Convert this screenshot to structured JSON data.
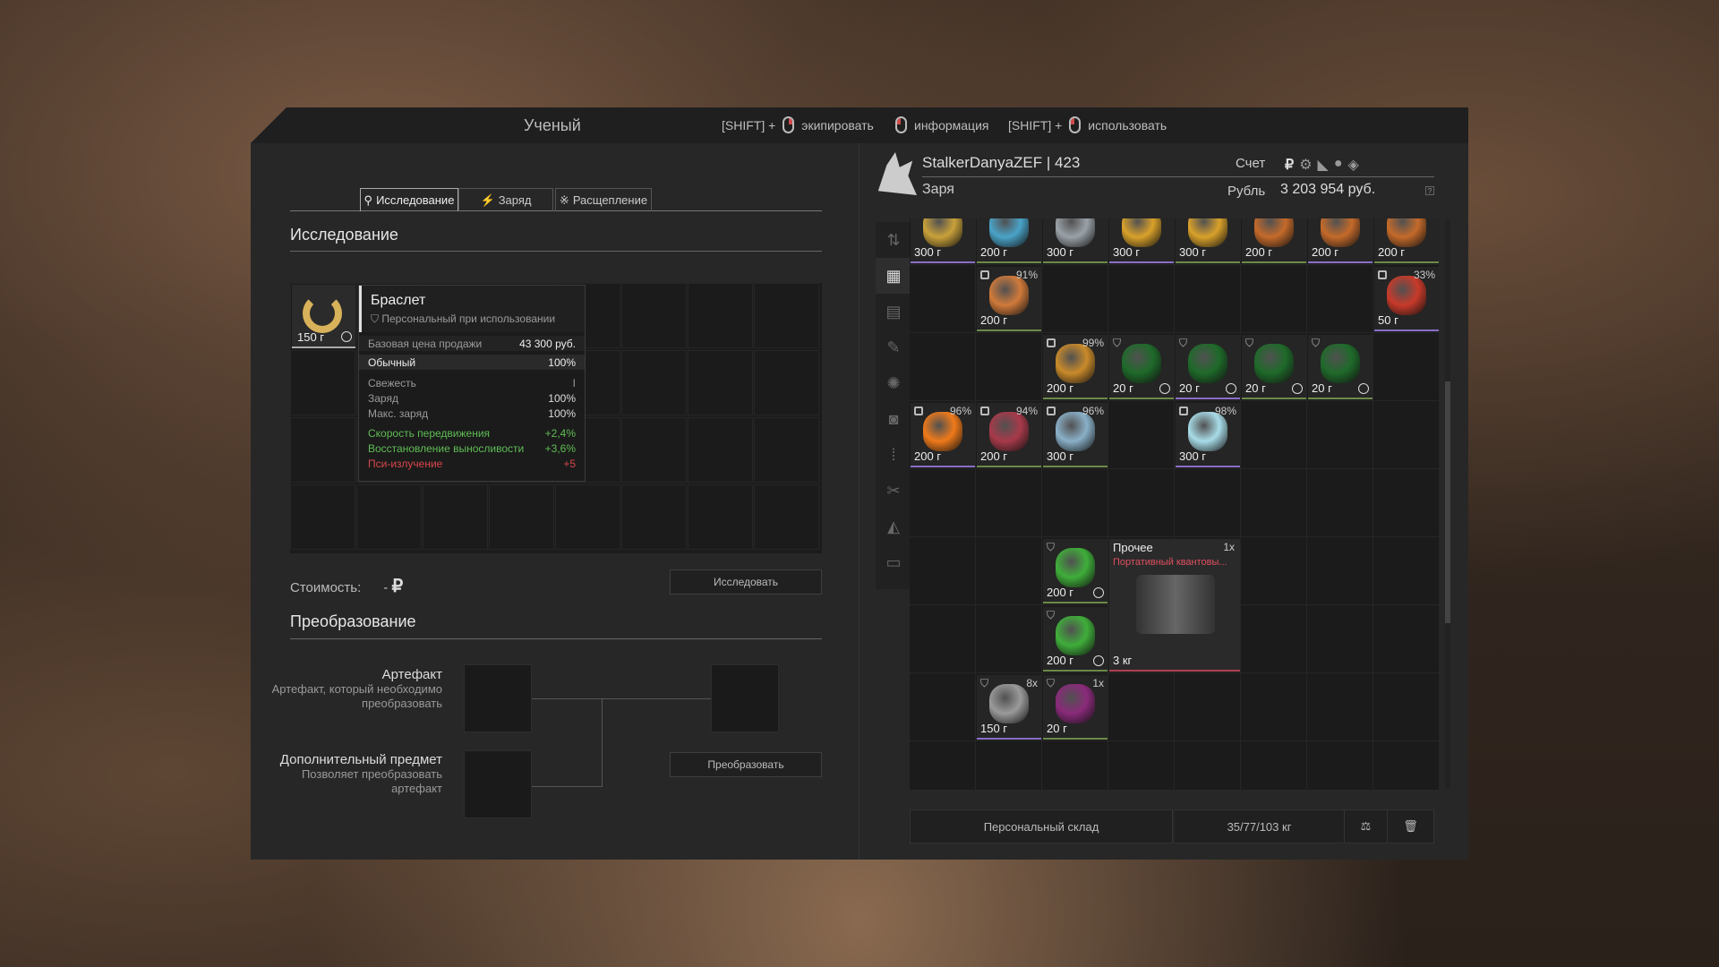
{
  "header": {
    "title": "Ученый",
    "hints": [
      {
        "prefix": "[SHIFT] +",
        "label": "экипировать"
      },
      {
        "prefix": "",
        "label": "информация"
      },
      {
        "prefix": "[SHIFT] +",
        "label": "использовать"
      }
    ]
  },
  "tabs": [
    {
      "label": "Исследование",
      "icon": "magnifier-icon",
      "active": true
    },
    {
      "label": "Заряд",
      "icon": "lightning-icon",
      "active": false
    },
    {
      "label": "Расщепление",
      "icon": "split-icon",
      "active": false
    }
  ],
  "research": {
    "title": "Исследование",
    "item_weight": "150 г",
    "tooltip": {
      "name": "Браслет",
      "subtitle": "Персональный при использовании",
      "base_price_label": "Базовая цена продажи",
      "base_price_value": "43 300 руб.",
      "rarity_label": "Обычный",
      "rarity_value": "100%",
      "freshness_label": "Свежесть",
      "freshness_value": "I",
      "charge_label": "Заряд",
      "charge_value": "100%",
      "max_charge_label": "Макс. заряд",
      "max_charge_value": "100%",
      "bonuses": [
        {
          "label": "Скорость передвижения",
          "value": "+2,4%",
          "color": "green"
        },
        {
          "label": "Восстановление выносливости",
          "value": "+3,6%",
          "color": "green"
        },
        {
          "label": "Пси-излучение",
          "value": "+5",
          "color": "red"
        }
      ]
    },
    "cost_label": "Стоимость:",
    "cost_value": "-",
    "currency_symbol": "₽",
    "button": "Исследовать"
  },
  "transform": {
    "title": "Преобразование",
    "artifact_label": "Артефакт",
    "artifact_desc": "Артефакт, который необходимо преобразовать",
    "extra_label": "Дополнительный предмет",
    "extra_desc": "Позволяет преобразовать артефакт",
    "button": "Преобразовать"
  },
  "account": {
    "player": "StalkerDanyaZEF | 423",
    "faction": "Заря",
    "account_label": "Счет",
    "currency_label": "Рубль",
    "balance": "3 203 954 руб."
  },
  "inventory": {
    "footer_label": "Персональный склад",
    "weight": "35/77/103 кг",
    "items": [
      {
        "w": "300 г",
        "c": "#c9a13a"
      },
      {
        "w": "200 г",
        "c": "#4aa3c8"
      },
      {
        "w": "300 г",
        "c": "#9aa2a8"
      },
      {
        "w": "300 г",
        "c": "#d9a12a"
      },
      {
        "w": "300 г",
        "c": "#d9a12a"
      },
      {
        "w": "200 г",
        "c": "#c46a2a"
      },
      {
        "w": "200 г",
        "c": "#c46a2a"
      },
      {
        "w": "200 г",
        "c": "#c46a2a"
      },
      {
        "w": "200 г",
        "c": "#d07a3a",
        "p": "91%"
      },
      {
        "w": "50 г",
        "c": "#c83a2a",
        "p": "33%"
      },
      {
        "w": "200 г",
        "c": "#c98a2a",
        "p": "99%"
      },
      {
        "w": "20 г",
        "c": "#1f6a2a"
      },
      {
        "w": "20 г",
        "c": "#1f6a2a"
      },
      {
        "w": "20 г",
        "c": "#1f6a2a"
      },
      {
        "w": "20 г",
        "c": "#1f6a2a"
      },
      {
        "w": "200 г",
        "c": "#f07a1a",
        "p": "96%"
      },
      {
        "w": "200 г",
        "c": "#a83a4a",
        "p": "94%"
      },
      {
        "w": "300 г",
        "c": "#8ab0c8",
        "p": "96%"
      },
      {
        "w": "300 г",
        "c": "#a8dce8",
        "p": "98%"
      },
      {
        "w": "200 г",
        "c": "#3fae3a"
      },
      {
        "w": "200 г",
        "c": "#3fae3a"
      },
      {
        "w": "150 г",
        "c": "#9a9a9a",
        "p": "8x"
      },
      {
        "w": "20 г",
        "c": "#8a2a7a",
        "p": "1x"
      }
    ],
    "big_item": {
      "category": "Прочее",
      "qty": "1x",
      "name": "Портативный квантовы...",
      "weight": "3 кг"
    }
  }
}
